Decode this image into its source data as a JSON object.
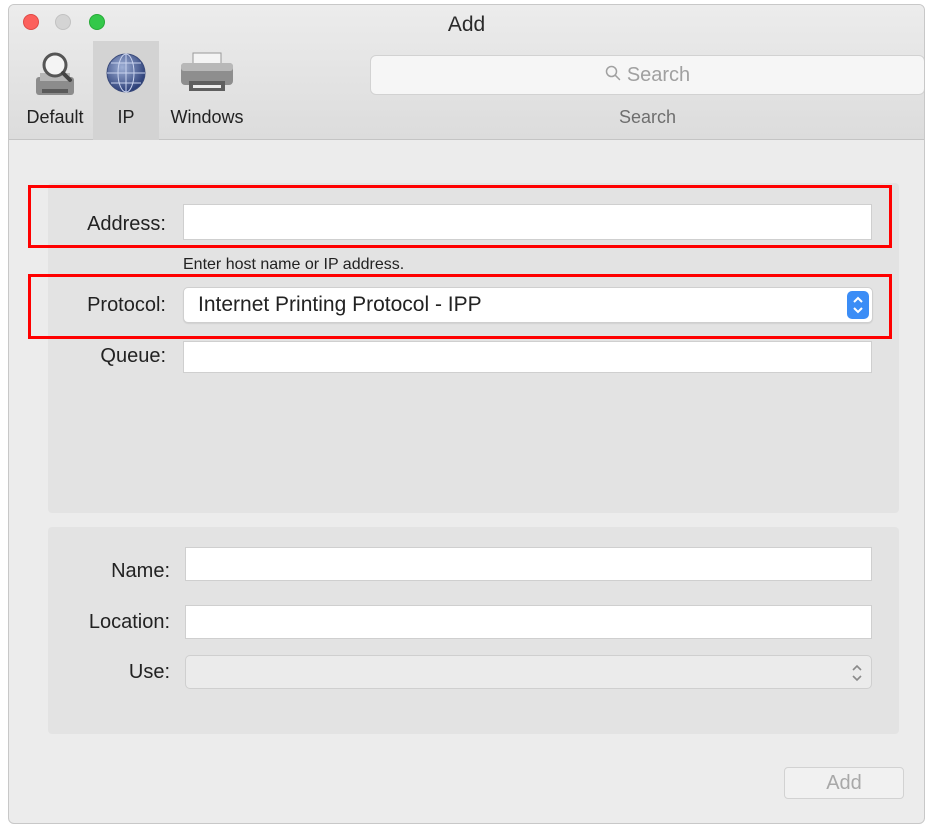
{
  "window": {
    "title": "Add"
  },
  "toolbar": {
    "items": [
      {
        "label": "Default",
        "icon": "default-printer-magnifier-icon"
      },
      {
        "label": "IP",
        "icon": "globe-icon",
        "selected": true
      },
      {
        "label": "Windows",
        "icon": "printer-icon"
      }
    ],
    "search": {
      "placeholder": "Search",
      "caption": "Search",
      "icon": "search-icon"
    }
  },
  "connection": {
    "address": {
      "label": "Address:",
      "value": "",
      "hint": "Enter host name or IP address."
    },
    "protocol": {
      "label": "Protocol:",
      "value": "Internet Printing Protocol - IPP"
    },
    "queue": {
      "label": "Queue:",
      "value": ""
    }
  },
  "details": {
    "name": {
      "label": "Name:",
      "value": ""
    },
    "location": {
      "label": "Location:",
      "value": ""
    },
    "use": {
      "label": "Use:",
      "value": ""
    }
  },
  "actions": {
    "add_label": "Add"
  },
  "colors": {
    "highlight_box": "#ff0000",
    "stepper_blue": "#3b8df6",
    "close": "#fc605c",
    "maximize": "#34c84a"
  }
}
